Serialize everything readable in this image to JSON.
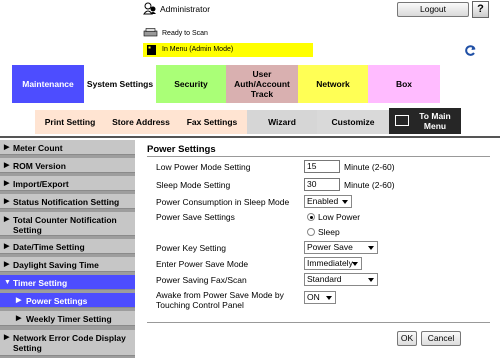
{
  "header": {
    "user_label": "Administrator",
    "logout_label": "Logout",
    "help_label": "?",
    "status": "Ready to Scan",
    "menu_status": "In Menu (Admin Mode)"
  },
  "tabs": [
    "Maintenance",
    "System Settings",
    "Security",
    "User Auth/Account Track",
    "Network",
    "Box"
  ],
  "subtabs": [
    "Print Setting",
    "Store Address",
    "Fax Settings",
    "Wizard",
    "Customize",
    "To Main Menu"
  ],
  "sidebar": {
    "items": [
      "Meter Count",
      "ROM Version",
      "Import/Export",
      "Status Notification Setting",
      "Total Counter Notification Setting",
      "Date/Time Setting",
      "Daylight Saving Time",
      "Timer Setting",
      "Power Settings",
      "Weekly Timer Setting",
      "Network Error Code Display Setting"
    ]
  },
  "main": {
    "title": "Power Settings",
    "low_power_label": "Low Power Mode Setting",
    "low_power_value": "15",
    "low_power_unit": "Minute (2-60)",
    "sleep_label": "Sleep Mode Setting",
    "sleep_value": "30",
    "sleep_unit": "Minute (2-60)",
    "consumption_label": "Power Consumption in Sleep Mode",
    "consumption_value": "Enabled",
    "save_settings_label": "Power Save Settings",
    "radio_low_power": "Low Power",
    "radio_sleep": "Sleep",
    "power_key_label": "Power Key Setting",
    "power_key_value": "Power Save",
    "enter_mode_label": "Enter Power Save Mode",
    "enter_mode_value": "Immediately",
    "fax_scan_label": "Power Saving Fax/Scan",
    "fax_scan_value": "Standard",
    "awake_label": "Awake from Power Save Mode by Touching Control Panel",
    "awake_value": "ON",
    "ok_label": "OK",
    "cancel_label": "Cancel"
  },
  "colors": {
    "active_tab": "#4d4dff",
    "status_bar": "#ffff00"
  },
  "icons": [
    "admin-user-icon",
    "printer-icon",
    "book-icon",
    "refresh-icon",
    "main-menu-icon",
    "triangle-right-icon",
    "triangle-down-icon"
  ]
}
